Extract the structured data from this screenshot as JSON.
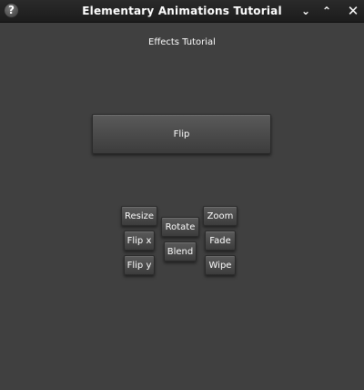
{
  "window": {
    "title": "Elementary Animations Tutorial",
    "help_icon": "?",
    "minimize_icon": "⌄",
    "maximize_icon": "⌃",
    "close_icon": "✕"
  },
  "content": {
    "subtitle": "Effects Tutorial",
    "flip_label": "Flip",
    "buttons": {
      "resize": "Resize",
      "flip_x": "Flip x",
      "flip_y": "Flip y",
      "rotate": "Rotate",
      "blend": "Blend",
      "zoom": "Zoom",
      "fade": "Fade",
      "wipe": "Wipe"
    }
  }
}
